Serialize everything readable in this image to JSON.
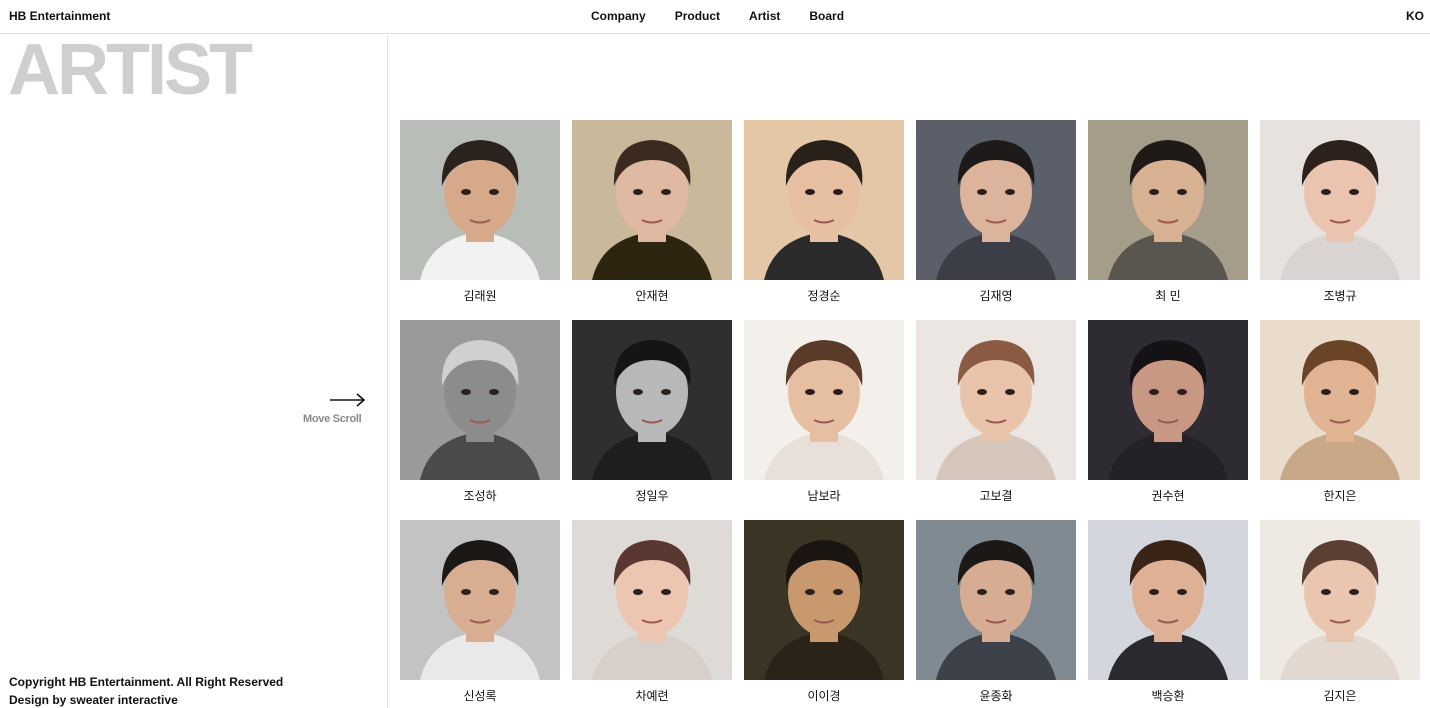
{
  "header": {
    "brand": "HB Entertainment",
    "nav": [
      "Company",
      "Product",
      "Artist",
      "Board"
    ],
    "lang": "KO"
  },
  "side": {
    "title": "ARTIST",
    "scroll_label": "Move Scroll",
    "copyright_line1": "Copyright HB Entertainment. All Right Reserved",
    "copyright_line2": "Design by sweater interactive"
  },
  "artists": [
    {
      "name": "김래원",
      "bg": "#b9bdb8",
      "skin": "#d6a98a",
      "hair": "#2a231d",
      "shirt": "#f2f2f2"
    },
    {
      "name": "안재현",
      "bg": "#c9b89a",
      "skin": "#e0b9a2",
      "hair": "#3a2a20",
      "shirt": "#2e2510"
    },
    {
      "name": "정경순",
      "bg": "#e3c7a6",
      "skin": "#e7c0a4",
      "hair": "#2b211b",
      "shirt": "#2a2a2a"
    },
    {
      "name": "김재영",
      "bg": "#5b5f6a",
      "skin": "#dcb49b",
      "hair": "#1e1a1a",
      "shirt": "#3b3e46"
    },
    {
      "name": "최 민",
      "bg": "#a69c8a",
      "skin": "#d8b092",
      "hair": "#1f1a17",
      "shirt": "#595650"
    },
    {
      "name": "조병규",
      "bg": "#e8e2df",
      "skin": "#eac4ae",
      "hair": "#2d211b",
      "shirt": "#d9d4d2"
    },
    {
      "name": "조성하",
      "bg": "#9a9a9a",
      "skin": "#8c8c8c",
      "hair": "#d0d0d0",
      "shirt": "#4a4a4a"
    },
    {
      "name": "정일우",
      "bg": "#2f2f2f",
      "skin": "#b8b8b8",
      "hair": "#151515",
      "shirt": "#1e1e1e"
    },
    {
      "name": "남보라",
      "bg": "#f3efea",
      "skin": "#e6bfa3",
      "hair": "#5a3b2a",
      "shirt": "#e8e0d8"
    },
    {
      "name": "고보결",
      "bg": "#ece6e2",
      "skin": "#eac3ab",
      "hair": "#8a5a42",
      "shirt": "#d6c7bd"
    },
    {
      "name": "권수현",
      "bg": "#2e2b33",
      "skin": "#c99882",
      "hair": "#141214",
      "shirt": "#242228"
    },
    {
      "name": "한지은",
      "bg": "#e9dccd",
      "skin": "#e0b392",
      "hair": "#6b4326",
      "shirt": "#c9a888"
    },
    {
      "name": "신성록",
      "bg": "#c3c3c3",
      "skin": "#d9ad92",
      "hair": "#1c1816",
      "shirt": "#e9e9e9"
    },
    {
      "name": "차예련",
      "bg": "#dedbd6",
      "skin": "#ecc6b1",
      "hair": "#5a3730",
      "shirt": "#d8cfc8"
    },
    {
      "name": "이이경",
      "bg": "#3a3424",
      "skin": "#c8986f",
      "hair": "#1a1510",
      "shirt": "#2a2418"
    },
    {
      "name": "윤종화",
      "bg": "#7f8a93",
      "skin": "#d6ad92",
      "hair": "#1c1816",
      "shirt": "#3c4048"
    },
    {
      "name": "백승환",
      "bg": "#d3d6dc",
      "skin": "#deb196",
      "hair": "#3a2418",
      "shirt": "#2a2a2e"
    },
    {
      "name": "김지은",
      "bg": "#efe9e4",
      "skin": "#eac5b0",
      "hair": "#5c3f33",
      "shirt": "#e2d8d0"
    }
  ]
}
